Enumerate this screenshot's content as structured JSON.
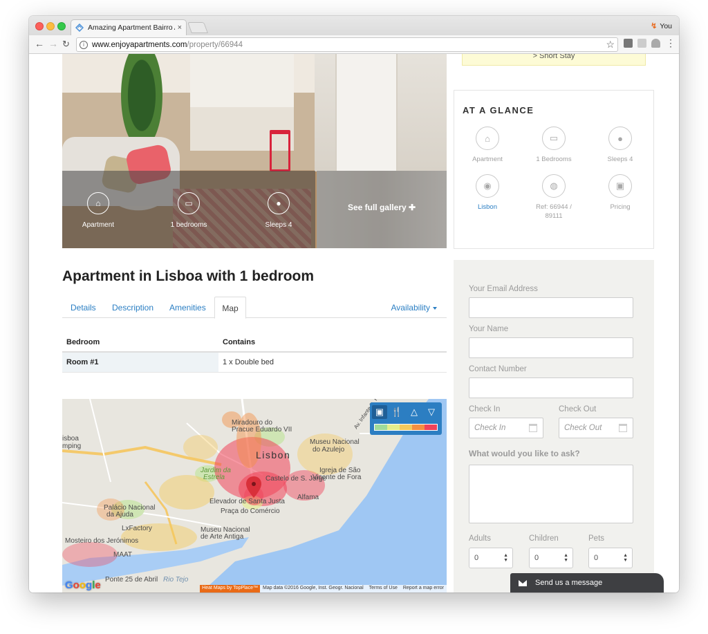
{
  "browser": {
    "tab_title": "Amazing Apartment Bairro Alto",
    "tab_close": "×",
    "profile_name": "You",
    "url_host": "www.enjoyapartments.com",
    "url_path": "/property/66944"
  },
  "hero": {
    "features": [
      {
        "icon": "home-icon",
        "glyph": "⌂",
        "label": "Apartment"
      },
      {
        "icon": "bed-icon",
        "glyph": "▭",
        "label": "1 bedrooms"
      },
      {
        "icon": "users-icon",
        "glyph": "●",
        "label": "Sleeps 4"
      }
    ],
    "gallery_link": "See full gallery ✚"
  },
  "sidebar": {
    "short_stay": "> Short Stay",
    "glance_title": "AT A GLANCE",
    "glance_items": [
      {
        "icon": "home-icon",
        "glyph": "⌂",
        "label": "Apartment"
      },
      {
        "icon": "bed-icon",
        "glyph": "▭",
        "label": "1 Bedrooms"
      },
      {
        "icon": "users-icon",
        "glyph": "●",
        "label": "Sleeps 4"
      },
      {
        "icon": "map-pin-icon",
        "glyph": "◉",
        "label": "Lisbon"
      },
      {
        "icon": "globe-icon",
        "glyph": "◍",
        "label": "Ref: 66944 / 89111"
      },
      {
        "icon": "money-icon",
        "glyph": "▣",
        "label": "Pricing"
      }
    ]
  },
  "form": {
    "email_label": "Your Email Address",
    "name_label": "Your Name",
    "phone_label": "Contact Number",
    "checkin_label": "Check In",
    "checkout_label": "Check Out",
    "checkin_placeholder": "Check In",
    "checkout_placeholder": "Check Out",
    "ask_label": "What would you like to ask?",
    "adults_label": "Adults",
    "children_label": "Children",
    "pets_label": "Pets",
    "adults_value": "0",
    "children_value": "0",
    "pets_value": "0"
  },
  "chat": {
    "label": "Send us a message"
  },
  "main": {
    "title": "Apartment in Lisboa with 1 bedroom",
    "tabs": [
      "Details",
      "Description",
      "Amenities",
      "Map"
    ],
    "availability": "Availability",
    "rooms_headers": [
      "Bedroom",
      "Contains"
    ],
    "rooms": [
      {
        "room": "Room #1",
        "contains": "1 x Double bed"
      }
    ]
  },
  "map": {
    "labels": {
      "city": "Lisbon",
      "miradouro": "Miradouro do",
      "miradouro2": "Pracue Eduardo VII",
      "museu_azulejo": "Museu Nacional",
      "museu_azulejo2": "do Azulejo",
      "jardim": "Jardim da",
      "jardim2": "Estrela",
      "castelo": "Castelo de S. Jorge",
      "igreja": "Igreja de São",
      "igreja2": "Vicente de Fora",
      "alfama": "Alfama",
      "elevador": "Elevador de Santa Justa",
      "praca": "Praça do Comércio",
      "palacio": "Palácio Nacional",
      "palacio2": "da Ajuda",
      "lxfactory": "LxFactory",
      "museu_arte": "Museu Nacional",
      "museu_arte2": "de Arte Antiga",
      "mosteiro": "Mosteiro dos Jerónimos",
      "maat": "MAAT",
      "ponte": "Ponte 25 de Abril",
      "rio": "Rio Tejo",
      "lisboa_camping": "isboa",
      "lisboa_camping2": "mping",
      "av_infante": "Av. Infante D. Henrique"
    },
    "tools": [
      {
        "icon": "camera-icon",
        "glyph": "▣"
      },
      {
        "icon": "restaurant-icon",
        "glyph": "🍴"
      },
      {
        "icon": "shopping-bag-icon",
        "glyph": "△"
      },
      {
        "icon": "cocktail-icon",
        "glyph": "▽"
      }
    ],
    "heat_colors": [
      "#9fdb9a",
      "#e4ee8c",
      "#f5c95c",
      "#f58f42",
      "#f0435a"
    ],
    "google": "Google",
    "heat_credit": "Heat Maps by TopPlace™",
    "map_data": "Map data ©2016 Google, Inst. Geogr. Nacional",
    "terms": "Terms of Use",
    "report": "Report a map error"
  }
}
